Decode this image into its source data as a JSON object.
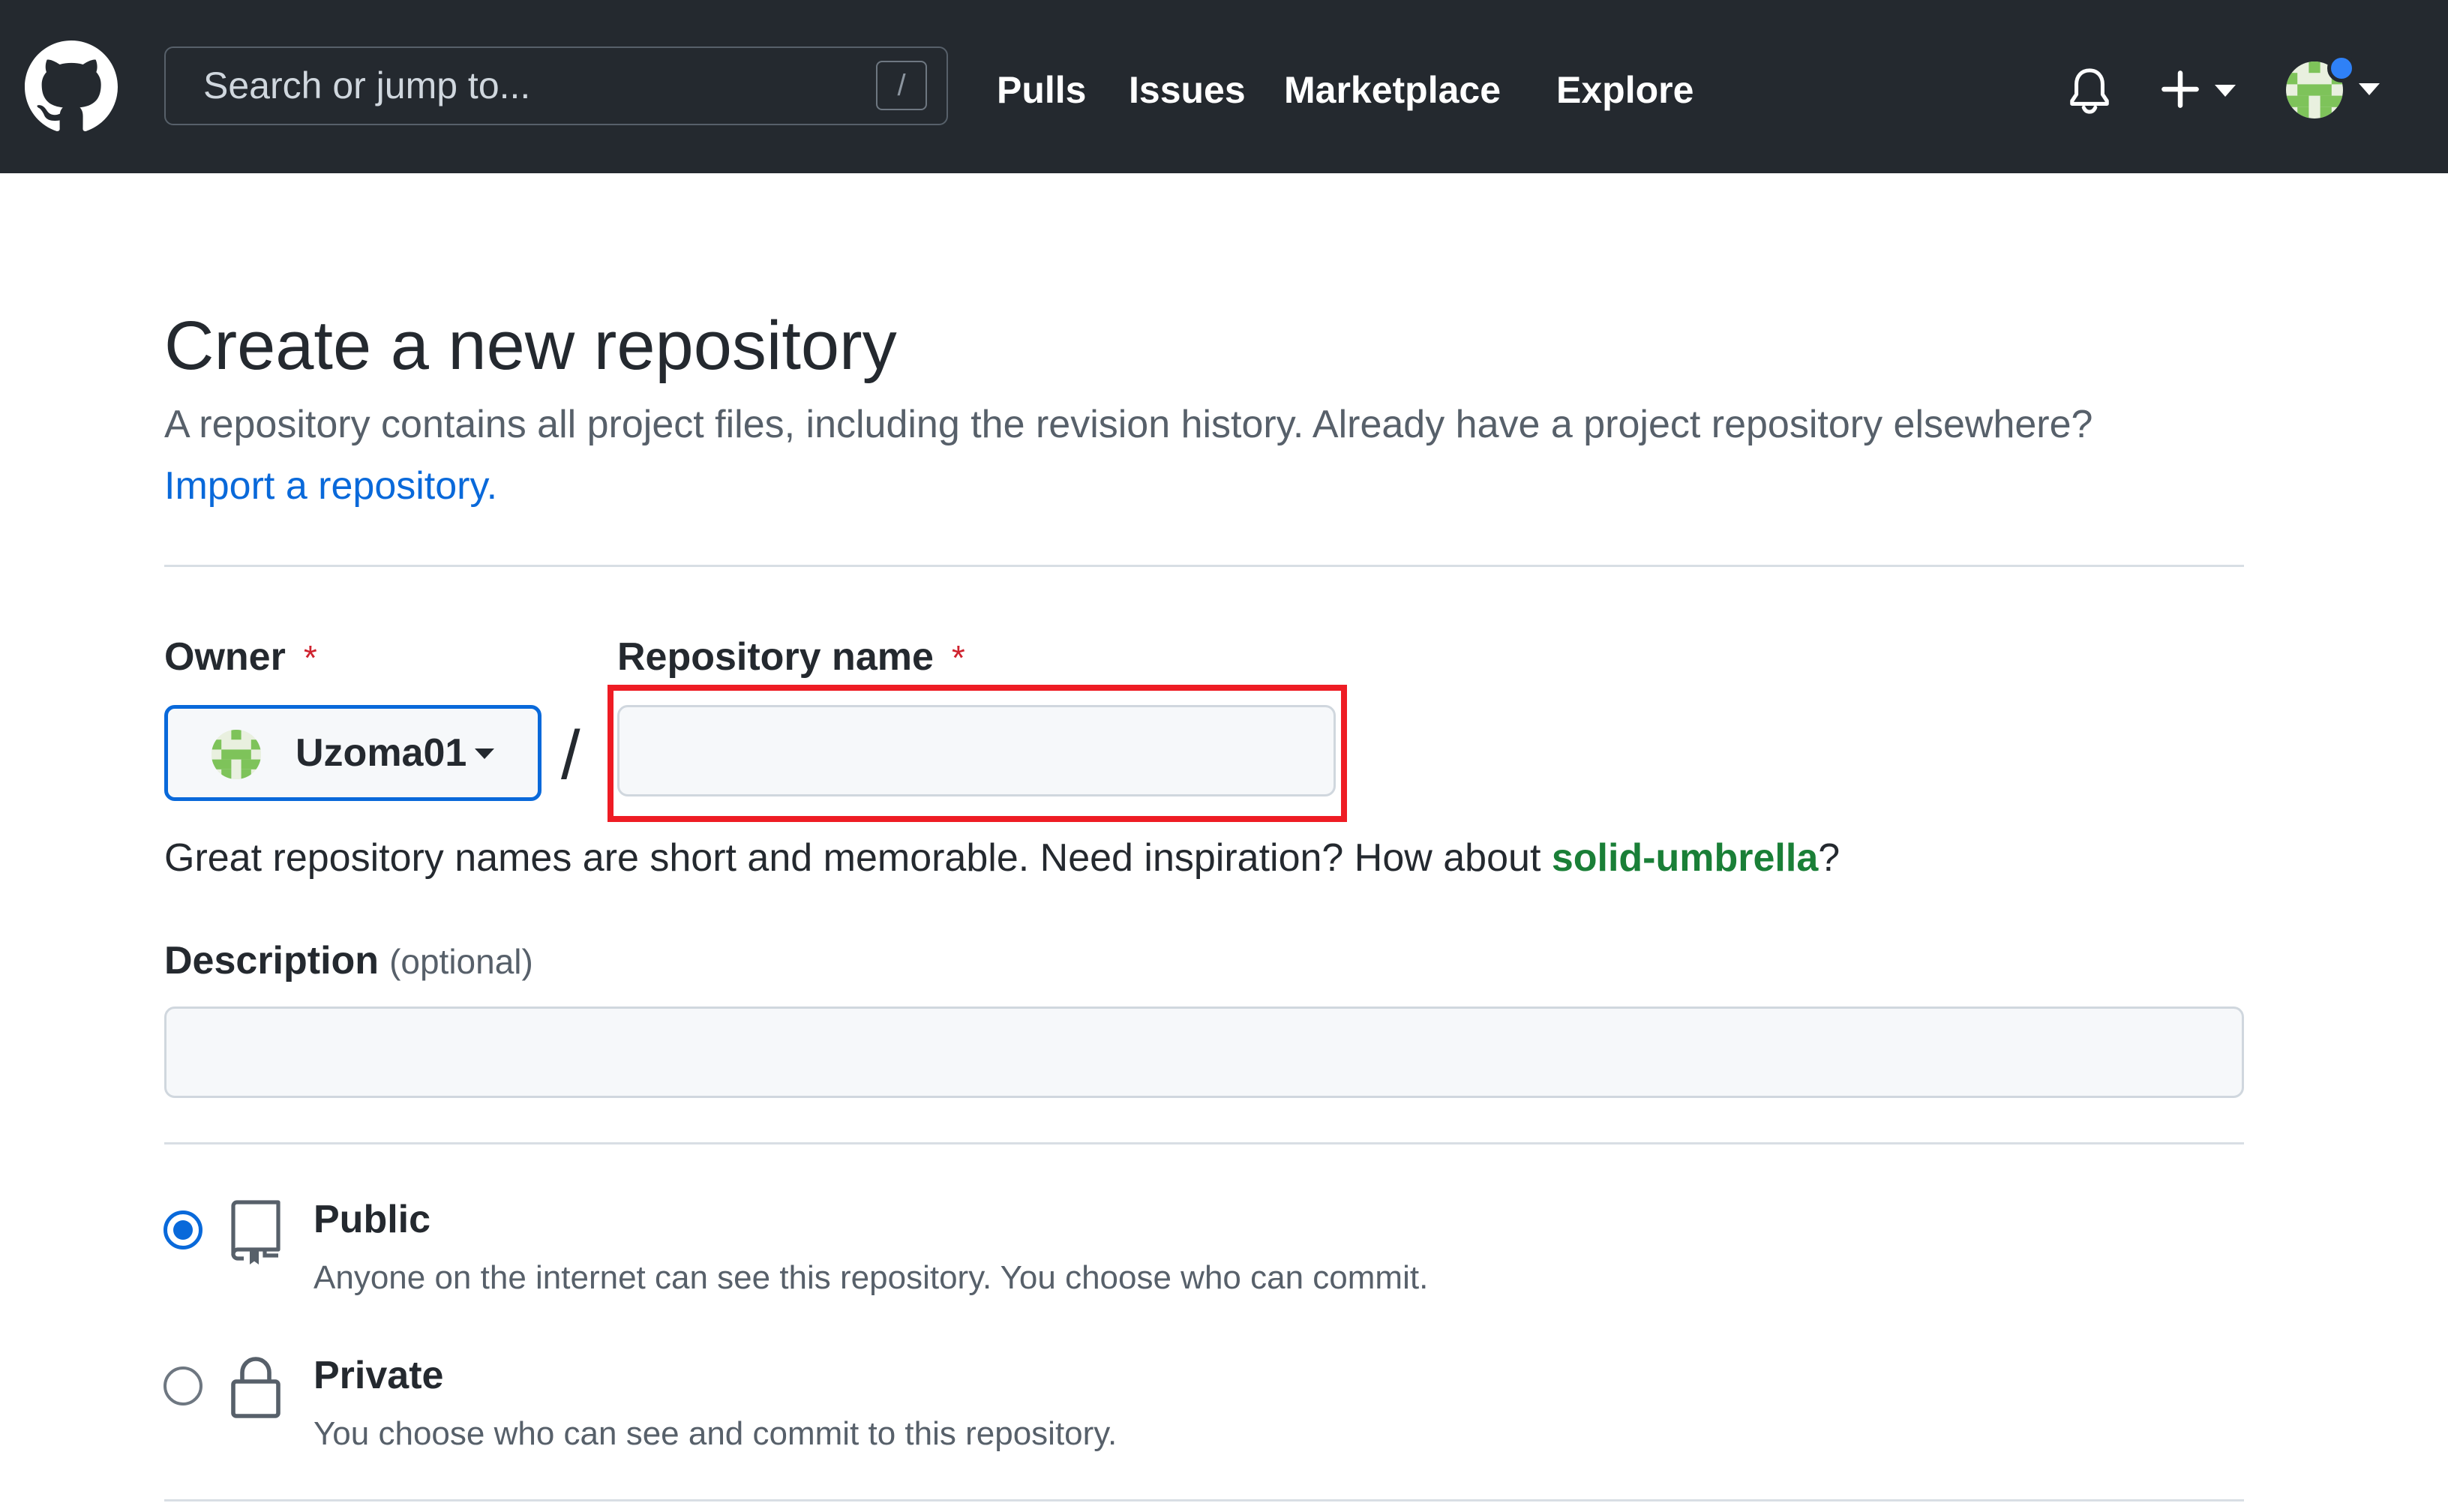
{
  "header": {
    "logo_icon": "github-mark-icon",
    "search_placeholder": "Search or jump to...",
    "search_shortcut": "/",
    "nav": [
      "Pulls",
      "Issues",
      "Marketplace",
      "Explore"
    ],
    "icons": [
      "bell-icon",
      "plus-icon",
      "avatar"
    ],
    "notification_color": "#2f81f7"
  },
  "main": {
    "title": "Create a new repository",
    "lead": "A repository contains all project files, including the revision history. Already have a project repository elsewhere?",
    "import_link": "Import a repository.",
    "owner": {
      "label": "Owner",
      "required_mark": "*",
      "value": "Uzoma01"
    },
    "separator": "/",
    "repo_name": {
      "label": "Repository name",
      "required_mark": "*",
      "value": ""
    },
    "suggestion": {
      "prefix": "Great repository names are short and memorable. Need inspiration? How about ",
      "name": "solid-umbrella",
      "suffix": "?"
    },
    "description": {
      "label": "Description",
      "optional": "(optional)",
      "value": ""
    },
    "visibility": {
      "selected": "Public",
      "options": [
        {
          "title": "Public",
          "description": "Anyone on the internet can see this repository. You choose who can commit.",
          "icon": "repo-icon"
        },
        {
          "title": "Private",
          "description": "You choose who can see and commit to this repository.",
          "icon": "lock-icon"
        }
      ]
    }
  },
  "colors": {
    "header_bg": "#24292f",
    "link": "#0969da",
    "suggestion": "#1a7f37",
    "required": "#cf222e",
    "highlight": "#ee1c24"
  }
}
